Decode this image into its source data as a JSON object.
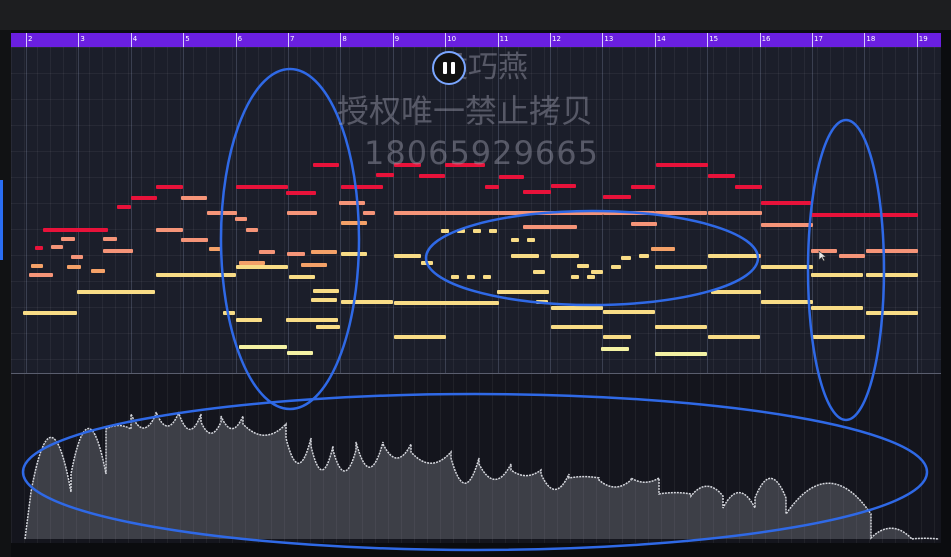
{
  "ruler": {
    "bar_numbers": [
      "2",
      "3",
      "4",
      "5",
      "6",
      "7",
      "8",
      "9",
      "10",
      "11",
      "12",
      "13",
      "14",
      "15",
      "16",
      "17",
      "18",
      "19"
    ]
  },
  "watermark": {
    "name": "侯巧燕",
    "rights": "授权唯一禁止拷贝",
    "phone": "18065929665"
  },
  "playback": {
    "control": "pause-icon"
  },
  "colors": {
    "ruler": "#6a1fe0",
    "note_red": "#e8123a",
    "note_salmon": "#f59478",
    "note_orange": "#f4a168",
    "note_yellow": "#f8dc86",
    "note_pale": "#f4f2a4",
    "annotation": "#2f69e6",
    "waveform": "#c8cad0"
  },
  "annotations": [
    "blue-ellipse-bars-6-7",
    "blue-ellipse-bars-10-14",
    "blue-ellipse-bar-17",
    "blue-ellipse-waveform"
  ]
}
